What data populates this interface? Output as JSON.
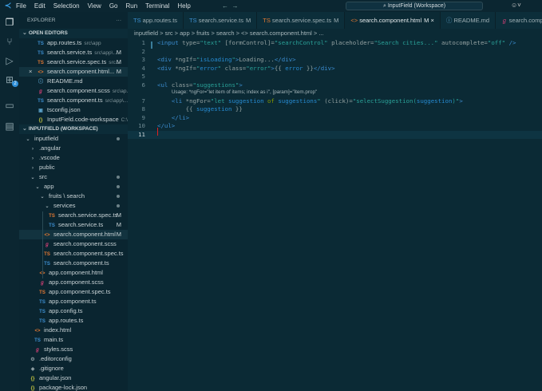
{
  "titlebar": {
    "menu": [
      "File",
      "Edit",
      "Selection",
      "View",
      "Go",
      "Run",
      "Terminal",
      "Help"
    ],
    "search": "InputField (Workspace)"
  },
  "activity": {
    "extensions_badge": "2"
  },
  "sidebar": {
    "title": "EXPLORER",
    "open_editors_label": "OPEN EDITORS",
    "open_editors": [
      {
        "name": "app.routes.ts",
        "desc": "src\\app",
        "icon": "TS",
        "type": "ts",
        "mark": ""
      },
      {
        "name": "search.service.ts",
        "desc": "src\\app\\...",
        "icon": "TS",
        "type": "ts",
        "mark": "M"
      },
      {
        "name": "search.service.spec.ts",
        "desc": "src...",
        "icon": "TS",
        "type": "tsspec",
        "mark": "M"
      },
      {
        "name": "search.component.html...",
        "desc": "",
        "icon": "<>",
        "type": "html",
        "mark": "M",
        "close": "×"
      },
      {
        "name": "README.md",
        "desc": "",
        "icon": "ⓘ",
        "type": "info",
        "mark": ""
      },
      {
        "name": "search.component.scss",
        "desc": "src\\ap...",
        "icon": "ℊ",
        "type": "scss",
        "mark": ""
      },
      {
        "name": "search.component.ts",
        "desc": "src\\app\\...",
        "icon": "TS",
        "type": "ts",
        "mark": ""
      },
      {
        "name": "tsconfig.json",
        "desc": "",
        "icon": "▣",
        "type": "info",
        "mark": ""
      },
      {
        "name": "InputField.code-workspace",
        "desc": "C:\\...",
        "icon": "{}",
        "type": "json",
        "mark": ""
      }
    ],
    "workspace_label": "INPUTFIELD (WORKSPACE)",
    "tree": [
      {
        "name": "inputfield",
        "depth": 0,
        "folder": "open",
        "dot": true
      },
      {
        "name": ".angular",
        "depth": 1,
        "folder": "closed"
      },
      {
        "name": ".vscode",
        "depth": 1,
        "folder": "closed"
      },
      {
        "name": "public",
        "depth": 1,
        "folder": "closed"
      },
      {
        "name": "src",
        "depth": 1,
        "folder": "open",
        "dot": true
      },
      {
        "name": "app",
        "depth": 2,
        "folder": "open",
        "dot": true
      },
      {
        "name": "fruits \\ search",
        "depth": 3,
        "folder": "open",
        "dot": true
      },
      {
        "name": "services",
        "depth": 4,
        "folder": "open",
        "dot": true
      },
      {
        "name": "search.service.spec.ts",
        "depth": 5,
        "icon": "TS",
        "type": "tsspec",
        "mark": "M"
      },
      {
        "name": "search.service.ts",
        "depth": 5,
        "icon": "TS",
        "type": "ts",
        "mark": "M"
      },
      {
        "name": "search.component.html",
        "depth": 4,
        "icon": "<>",
        "type": "html",
        "mark": "M",
        "selected": true
      },
      {
        "name": "search.component.scss",
        "depth": 4,
        "icon": "ℊ",
        "type": "scss"
      },
      {
        "name": "search.component.spec.ts",
        "depth": 4,
        "icon": "TS",
        "type": "tsspec"
      },
      {
        "name": "search.component.ts",
        "depth": 4,
        "icon": "TS",
        "type": "ts"
      },
      {
        "name": "app.component.html",
        "depth": 3,
        "icon": "<>",
        "type": "html"
      },
      {
        "name": "app.component.scss",
        "depth": 3,
        "icon": "ℊ",
        "type": "scss"
      },
      {
        "name": "app.component.spec.ts",
        "depth": 3,
        "icon": "TS",
        "type": "tsspec"
      },
      {
        "name": "app.component.ts",
        "depth": 3,
        "icon": "TS",
        "type": "ts"
      },
      {
        "name": "app.config.ts",
        "depth": 3,
        "icon": "TS",
        "type": "ts"
      },
      {
        "name": "app.routes.ts",
        "depth": 3,
        "icon": "TS",
        "type": "ts"
      },
      {
        "name": "index.html",
        "depth": 2,
        "icon": "<>",
        "type": "html"
      },
      {
        "name": "main.ts",
        "depth": 2,
        "icon": "TS",
        "type": "ts"
      },
      {
        "name": "styles.scss",
        "depth": 2,
        "icon": "ℊ",
        "type": "scss"
      },
      {
        "name": ".editorconfig",
        "depth": 1,
        "icon": "⚙",
        "type": "cfg"
      },
      {
        "name": ".gitignore",
        "depth": 1,
        "icon": "◆",
        "type": "cfg"
      },
      {
        "name": "angular.json",
        "depth": 1,
        "icon": "{}",
        "type": "json"
      },
      {
        "name": "package-lock.json",
        "depth": 1,
        "icon": "{}",
        "type": "json"
      }
    ]
  },
  "tabs": [
    {
      "label": "app.routes.ts",
      "icon": "TS",
      "type": "ts",
      "mark": ""
    },
    {
      "label": "search.service.ts",
      "icon": "TS",
      "type": "ts",
      "mark": "M"
    },
    {
      "label": "search.service.spec.ts",
      "icon": "TS",
      "type": "tsspec",
      "mark": "M"
    },
    {
      "label": "search.component.html",
      "icon": "<>",
      "type": "html",
      "mark": "M ×",
      "active": true
    },
    {
      "label": "README.md",
      "icon": "ⓘ",
      "type": "info",
      "mark": ""
    },
    {
      "label": "search.compo",
      "icon": "ℊ",
      "type": "scss",
      "mark": ""
    }
  ],
  "breadcrumb": "inputfield > src > app > fruits > search > <> search.component.html > ...",
  "code": {
    "hint": "Usage: *ngFor=\"let item of items; index as i\", [param]=\"item.prop\"",
    "lines": [
      [
        [
          "tag",
          "<input "
        ],
        [
          "attr",
          "type="
        ],
        [
          "str",
          "\"text\" "
        ],
        [
          "attr",
          "[formControl]="
        ],
        [
          "str",
          "\"searchControl\" "
        ],
        [
          "attr",
          "placeholder="
        ],
        [
          "str",
          "\"Search cities...\" "
        ],
        [
          "attr",
          "autocomplete="
        ],
        [
          "str",
          "\"off\" "
        ],
        [
          "tag",
          "/>"
        ]
      ],
      [],
      [
        [
          "tag",
          "<div "
        ],
        [
          "attr",
          "*ngIf="
        ],
        [
          "str",
          "\""
        ],
        [
          "var",
          "isLoading"
        ],
        [
          "str",
          "\""
        ],
        [
          "tag",
          ">"
        ],
        [
          "txt",
          "Loading..."
        ],
        [
          "tag",
          "</div>"
        ]
      ],
      [
        [
          "tag",
          "<div "
        ],
        [
          "attr",
          "*ngIf="
        ],
        [
          "str",
          "\""
        ],
        [
          "var",
          "error"
        ],
        [
          "str",
          "\" "
        ],
        [
          "attr",
          "class="
        ],
        [
          "str",
          "\"error\""
        ],
        [
          "tag",
          ">"
        ],
        [
          "txt",
          "{{ "
        ],
        [
          "var",
          "error"
        ],
        [
          "txt",
          " }}"
        ],
        [
          "tag",
          "</div>"
        ]
      ],
      [],
      [
        [
          "tag",
          "<ul "
        ],
        [
          "attr",
          "class="
        ],
        [
          "str",
          "\"suggestions\""
        ],
        [
          "tag",
          ">"
        ]
      ],
      [
        [
          "txt",
          "    "
        ],
        [
          "tag",
          "<li "
        ],
        [
          "attr",
          "*ngFor="
        ],
        [
          "str",
          "\"let "
        ],
        [
          "var",
          "suggestion "
        ],
        [
          "kw",
          "of "
        ],
        [
          "var",
          "suggestions"
        ],
        [
          "str",
          "\" "
        ],
        [
          "attr",
          "(click)="
        ],
        [
          "str",
          "\"selectSuggestion("
        ],
        [
          "var",
          "suggestion"
        ],
        [
          "str",
          ")\""
        ],
        [
          "tag",
          ">"
        ]
      ],
      [
        [
          "txt",
          "        {{ "
        ],
        [
          "var",
          "suggestion"
        ],
        [
          "txt",
          " }}"
        ]
      ],
      [
        [
          "txt",
          "    "
        ],
        [
          "tag",
          "</li>"
        ]
      ],
      [
        [
          "tag",
          "</ul>"
        ]
      ],
      []
    ]
  }
}
